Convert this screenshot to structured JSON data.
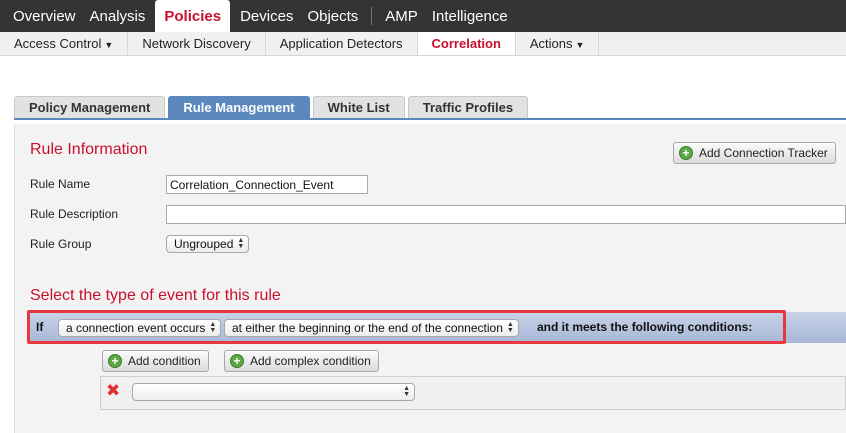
{
  "topnav": {
    "items": [
      "Overview",
      "Analysis",
      "Policies",
      "Devices",
      "Objects",
      "AMP",
      "Intelligence"
    ],
    "active": "Policies"
  },
  "subnav": {
    "access_control": "Access Control",
    "network_discovery": "Network Discovery",
    "application_detectors": "Application Detectors",
    "correlation": "Correlation",
    "actions": "Actions",
    "active": "Correlation"
  },
  "tabs": {
    "policy_management": "Policy Management",
    "rule_management": "Rule Management",
    "white_list": "White List",
    "traffic_profiles": "Traffic Profiles",
    "active": "Rule Management"
  },
  "rule_info": {
    "title": "Rule Information",
    "add_connection_tracker": "Add Connection Tracker",
    "rule_name_label": "Rule Name",
    "rule_name_value": "Correlation_Connection_Event",
    "rule_description_label": "Rule Description",
    "rule_description_value": "",
    "rule_group_label": "Rule Group",
    "rule_group_value": "Ungrouped"
  },
  "event": {
    "title": "Select the type of event for this rule",
    "if_label": "If",
    "event_type": "a connection event occurs",
    "event_timing": "at either the beginning or the end of the connection",
    "meets_label": "and it meets the following conditions:"
  },
  "conditions": {
    "add_condition": "Add condition",
    "add_complex_condition": "Add complex condition",
    "condition_select_value": ""
  },
  "colors": {
    "accent_red": "#c8102e",
    "tab_blue": "#5b88bd",
    "highlight_red": "#e8383f",
    "nav_dark": "#343434"
  }
}
